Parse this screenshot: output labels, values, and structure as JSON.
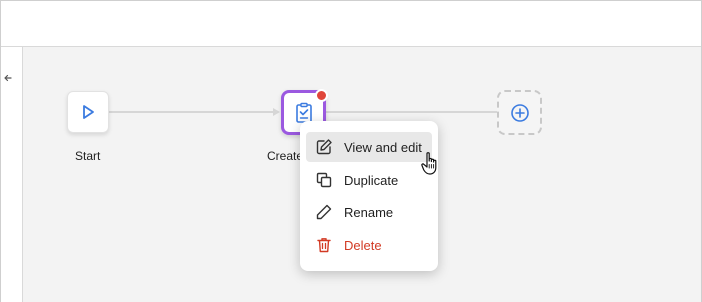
{
  "colors": {
    "accent_purple": "#9b59e0",
    "primary_blue": "#3b7be0",
    "danger_red": "#d23a24",
    "notification_dot": "#e0463a",
    "canvas_bg": "#f3f3f3"
  },
  "sidebar": {
    "collapse_icon": "arrow-left-icon"
  },
  "workflow": {
    "nodes": [
      {
        "id": "start",
        "label": "Start",
        "icon": "play-icon"
      },
      {
        "id": "create",
        "label": "Create",
        "icon": "clipboard-check-icon",
        "has_notification": true,
        "selected": true
      },
      {
        "id": "add",
        "label": "",
        "icon": "plus-circle-icon"
      }
    ]
  },
  "context_menu": {
    "items": [
      {
        "label": "View and edit",
        "icon": "edit-icon",
        "hovered": true
      },
      {
        "label": "Duplicate",
        "icon": "duplicate-icon"
      },
      {
        "label": "Rename",
        "icon": "pencil-icon"
      },
      {
        "label": "Delete",
        "icon": "trash-icon",
        "danger": true
      }
    ]
  },
  "cursor": "hand-pointer-icon"
}
